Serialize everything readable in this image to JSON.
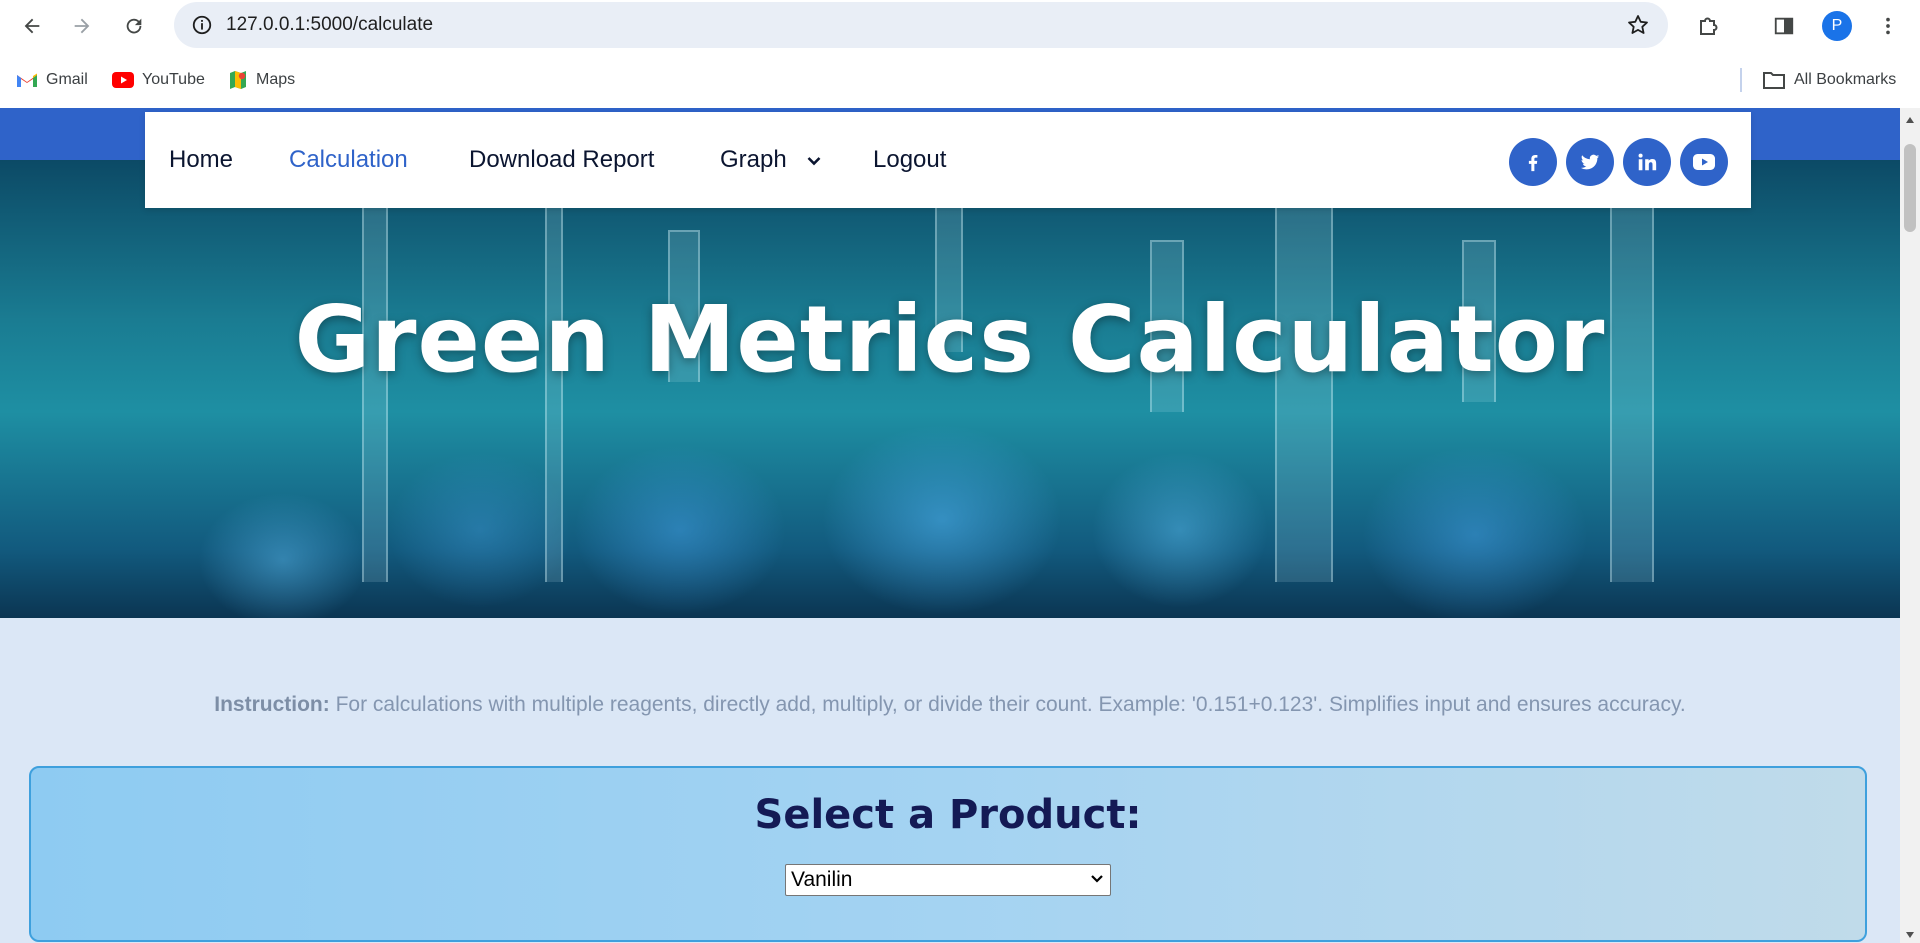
{
  "browser": {
    "url": "127.0.0.1:5000/calculate",
    "profile_initial": "P",
    "bookmarks": [
      {
        "label": "Gmail",
        "icon": "gmail-icon"
      },
      {
        "label": "YouTube",
        "icon": "youtube-icon"
      },
      {
        "label": "Maps",
        "icon": "maps-icon"
      }
    ],
    "all_bookmarks_label": "All Bookmarks"
  },
  "nav": {
    "links": [
      {
        "label": "Home",
        "active": false
      },
      {
        "label": "Calculation",
        "active": true
      },
      {
        "label": "Download Report",
        "active": false
      },
      {
        "label": "Graph",
        "active": false,
        "dropdown": true
      },
      {
        "label": "Logout",
        "active": false
      }
    ],
    "social": [
      "facebook-icon",
      "twitter-icon",
      "linkedin-icon",
      "youtube-icon"
    ]
  },
  "hero": {
    "title": "Green Metrics Calculator"
  },
  "instruction": {
    "label": "Instruction:",
    "text": "For calculations with multiple reagents, directly add, multiply, or divide their count. Example: '0.151+0.123'. Simplifies input and ensures accuracy."
  },
  "product": {
    "title": "Select a Product:",
    "selected": "Vanilin"
  },
  "colors": {
    "brand_blue": "#2f63c9",
    "page_bg": "#dbe7f6",
    "title_navy": "#141a55"
  }
}
